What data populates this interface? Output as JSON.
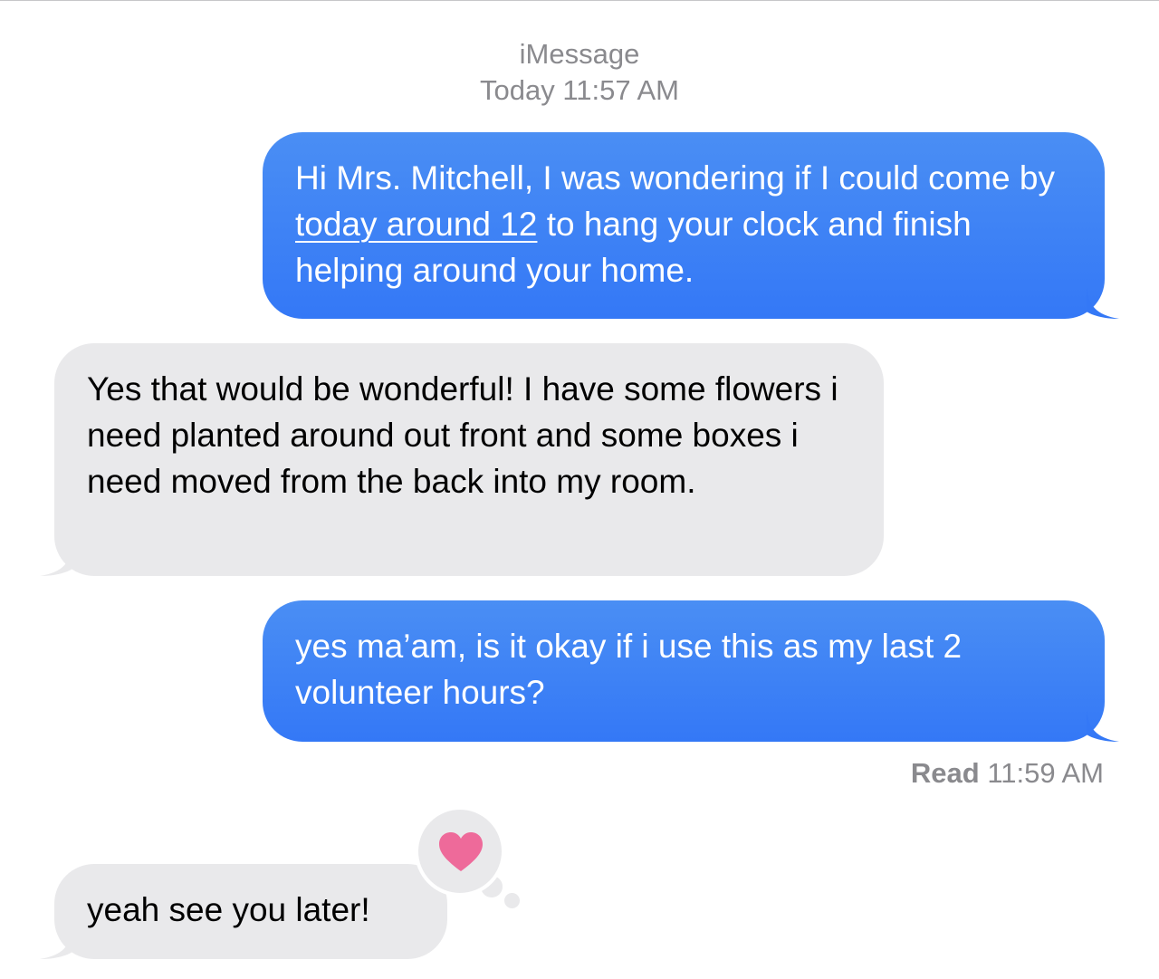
{
  "header": {
    "service": "iMessage",
    "timestamp": "Today 11:57 AM"
  },
  "messages": [
    {
      "direction": "outgoing",
      "text_before": "Hi Mrs. Mitchell,  I was wondering if I could come by ",
      "link": "today around 12",
      "text_after": " to hang your clock and finish helping around your home."
    },
    {
      "direction": "incoming",
      "text": "Yes that would be wonderful! I have some flowers i need planted around out front and some boxes i need moved from the back into my room."
    },
    {
      "direction": "outgoing",
      "text": "yes ma’am, is it okay if i use this as my last 2 volunteer hours?"
    },
    {
      "direction": "incoming",
      "text": "yeah see you later!",
      "reaction": "heart-icon"
    }
  ],
  "receipt": {
    "status": "Read",
    "time": "11:59 AM"
  },
  "colors": {
    "outgoing_bubble": "#3478f6",
    "incoming_bubble": "#e9e9eb",
    "meta_text": "#8a8a8e",
    "heart": "#ee6a9a"
  }
}
